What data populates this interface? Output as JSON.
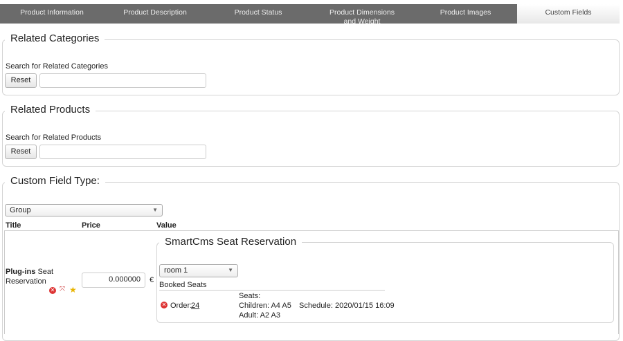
{
  "tabs": [
    "Product Information",
    "Product Description",
    "Product Status",
    "Product Dimensions and Weight",
    "Product Images",
    "Custom Fields"
  ],
  "related_categories": {
    "legend": "Related Categories",
    "label": "Search for Related Categories",
    "reset": "Reset",
    "value": ""
  },
  "related_products": {
    "legend": "Related Products",
    "label": "Search for Related Products",
    "reset": "Reset",
    "value": ""
  },
  "custom_field": {
    "legend": "Custom Field Type:",
    "type_selected": "Group",
    "headers": {
      "title": "Title",
      "price": "Price",
      "value": "Value"
    },
    "row": {
      "title_bold": "Plug-ins",
      "title_rest": " Seat Reservation",
      "price": "0.000000",
      "currency": "€",
      "plugin": {
        "legend": "SmartCms Seat Reservation",
        "room_selected": "room 1",
        "booked_label": "Booked Seats",
        "order_label": "Order:",
        "order_number": "24",
        "seats_label": "Seats:",
        "children": "Children: A4 A5",
        "adult": "Adult: A2 A3",
        "schedule": "Schedule: 2020/01/15 16:09"
      }
    }
  }
}
